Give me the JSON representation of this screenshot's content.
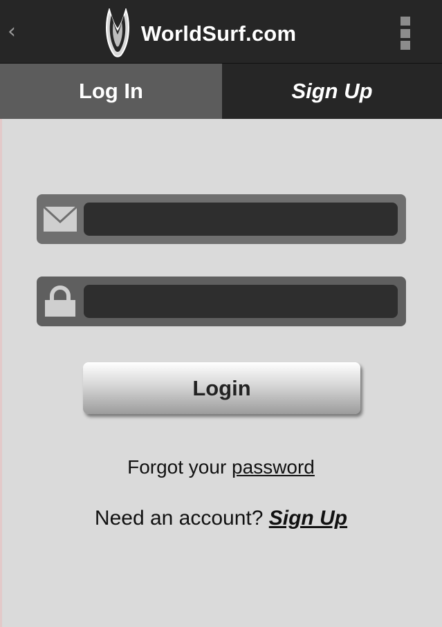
{
  "header": {
    "back_icon": "chevron-left-icon",
    "logo_icon": "surfboard-logo-icon",
    "brand_name": "WorldSurf.com",
    "menu_icon": "overflow-menu-icon"
  },
  "tabs": [
    {
      "label": "Log In",
      "active": true
    },
    {
      "label": "Sign Up",
      "active": false
    }
  ],
  "form": {
    "email": {
      "icon": "envelope-icon",
      "value": "",
      "placeholder": ""
    },
    "password": {
      "icon": "lock-icon",
      "value": "",
      "placeholder": ""
    },
    "submit_label": "Login"
  },
  "links": {
    "forgot_prefix": "Forgot your ",
    "forgot_link": "password",
    "need_prefix": "Need an account? ",
    "signup_link": "Sign Up"
  },
  "colors": {
    "topbar": "#262626",
    "active_tab": "#5c5c5c",
    "background": "#dadada"
  }
}
